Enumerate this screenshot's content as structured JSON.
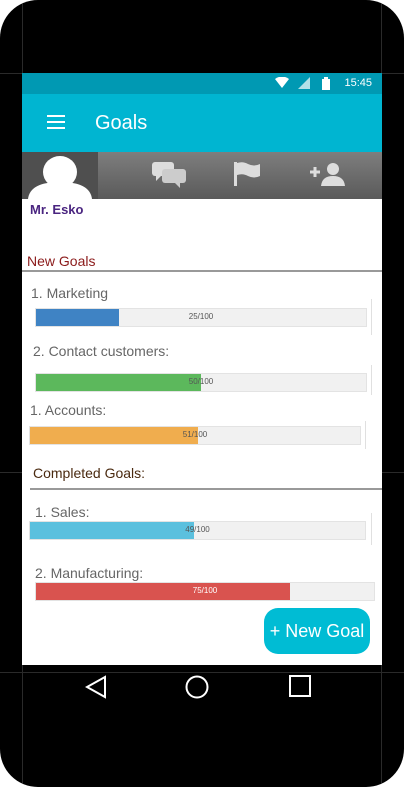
{
  "status_bar": {
    "time": "15:45"
  },
  "app_bar": {
    "title": "Goals"
  },
  "profile": {
    "name": "Mr. Esko"
  },
  "sections": {
    "new_goals": "New Goals",
    "completed_goals": "Completed Goals:"
  },
  "new_goals": [
    {
      "label": "1. Marketing",
      "value_text": "25/100",
      "progress": 25,
      "color": "#3f83c4"
    },
    {
      "label": "2. Contact customers:",
      "value_text": "50/100",
      "progress": 50,
      "color": "#5cb85c"
    },
    {
      "label": "1. Accounts:",
      "value_text": "51/100",
      "progress": 51,
      "color": "#f0ad4e"
    }
  ],
  "completed_goals": [
    {
      "label": "1. Sales:",
      "value_text": "49/100",
      "progress": 49,
      "color": "#5bc0de"
    },
    {
      "label": "2. Manufacturing:",
      "value_text": "75/100",
      "progress": 75,
      "color": "#d9534f"
    }
  ],
  "fab": {
    "label": "+ New Goal"
  },
  "colors": {
    "status": "#0099b3",
    "appbar": "#00b5d1",
    "fab": "#00bcd4"
  },
  "icons": [
    "menu-icon",
    "chat-icon",
    "flag-icon",
    "add-user-icon",
    "avatar-icon",
    "back-icon",
    "home-icon",
    "recents-icon"
  ]
}
